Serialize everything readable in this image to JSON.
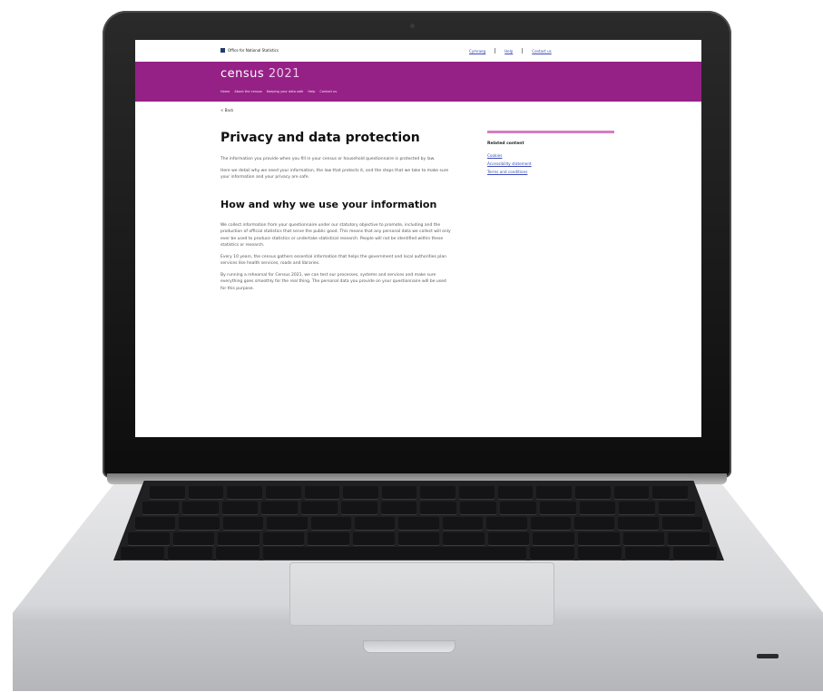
{
  "gov_header": {
    "logo_text": "Office for National Statistics",
    "links": [
      "Cymraeg",
      "Help",
      "Contact us"
    ]
  },
  "banner": {
    "brand_word": "census",
    "brand_year": "2021",
    "nav": [
      "Home",
      "About the census",
      "Keeping your data safe",
      "Help",
      "Contact us"
    ]
  },
  "breadcrumb": "< Back",
  "page": {
    "title": "Privacy and data protection",
    "intro": [
      "The information you provide when you fill in your census or household questionnaire is protected by law.",
      "Here we detail why we need your information, the law that protects it, and the steps that we take to make sure your information and your privacy are safe."
    ],
    "section_heading": "How and why we use your information",
    "section_paragraphs": [
      "We collect information from your questionnaire under our statutory objective to promote, including and the production of official statistics that serve the public good. This means that any personal data we collect will only ever be used to produce statistics or undertake statistical research. People will not be identified within these statistics or research.",
      "Every 10 years, the census gathers essential information that helps the government and local authorities plan services like health services, roads and libraries.",
      "By running a rehearsal for Census 2021, we can test our processes, systems and services and make sure everything goes smoothly for the real thing. The personal data you provide on your questionnaire will be used for this purpose."
    ]
  },
  "sidebar": {
    "title": "Related content",
    "links": [
      "Cookies",
      "Accessibility statement",
      "Terms and conditions"
    ]
  },
  "colors": {
    "banner": "#962186",
    "accent_line": "#d17fc4",
    "link": "#3b4cb8"
  }
}
